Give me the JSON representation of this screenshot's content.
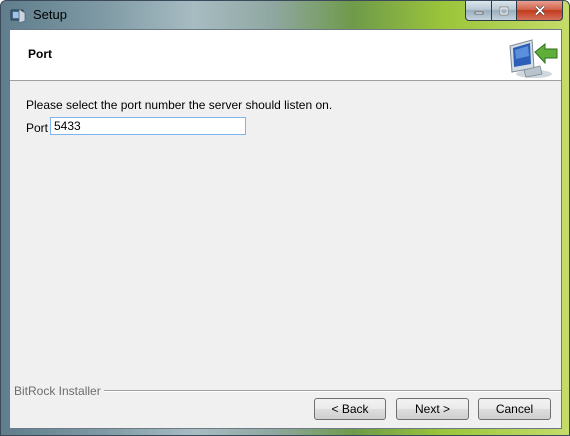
{
  "window": {
    "title": "Setup",
    "icons": {
      "app": "setup-app-icon",
      "minimize": "minimize-icon",
      "maximize": "maximize-icon",
      "close": "close-icon"
    }
  },
  "header": {
    "title": "Port",
    "icon": "computer-arrow-icon"
  },
  "content": {
    "prompt": "Please select the port number the server should listen on.",
    "port_label": "Port",
    "port_value": "5433"
  },
  "footer": {
    "brand": "BitRock Installer",
    "back_label": "< Back",
    "next_label": "Next >",
    "cancel_label": "Cancel"
  }
}
